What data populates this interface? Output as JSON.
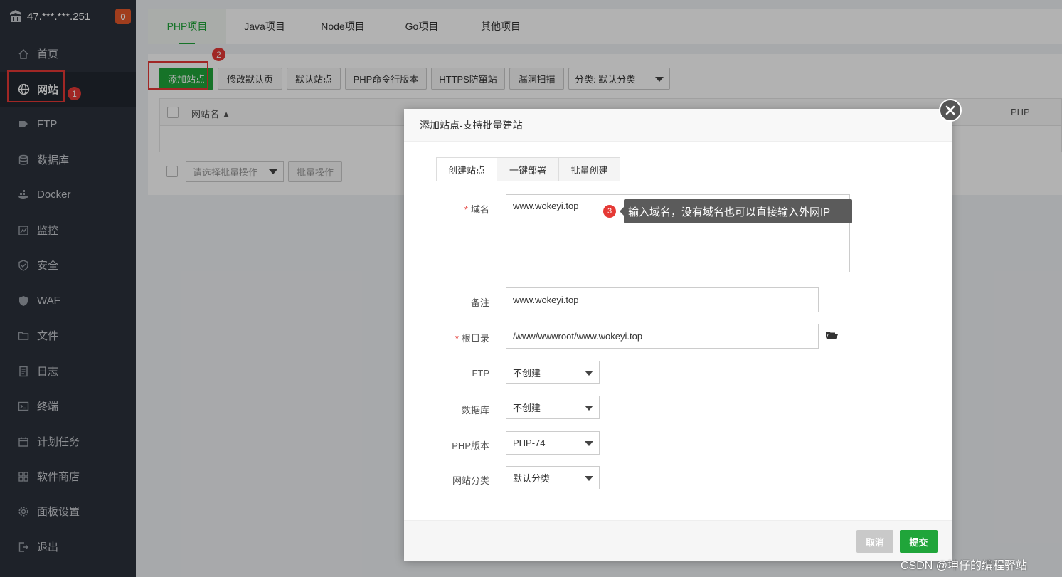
{
  "sidebar": {
    "host": "47.***.***.251",
    "badge": "0",
    "items": [
      {
        "label": "首页",
        "icon": "home-icon"
      },
      {
        "label": "网站",
        "icon": "globe-icon"
      },
      {
        "label": "FTP",
        "icon": "ftp-icon"
      },
      {
        "label": "数据库",
        "icon": "database-icon"
      },
      {
        "label": "Docker",
        "icon": "docker-icon"
      },
      {
        "label": "监控",
        "icon": "monitor-icon"
      },
      {
        "label": "安全",
        "icon": "shield-icon"
      },
      {
        "label": "WAF",
        "icon": "waf-icon"
      },
      {
        "label": "文件",
        "icon": "folder-icon"
      },
      {
        "label": "日志",
        "icon": "log-icon"
      },
      {
        "label": "终端",
        "icon": "terminal-icon"
      },
      {
        "label": "计划任务",
        "icon": "calendar-icon"
      },
      {
        "label": "软件商店",
        "icon": "store-icon"
      },
      {
        "label": "面板设置",
        "icon": "gear-icon"
      },
      {
        "label": "退出",
        "icon": "logout-icon"
      }
    ],
    "active_index": 1
  },
  "tabs": [
    "PHP项目",
    "Java项目",
    "Node项目",
    "Go项目",
    "其他项目"
  ],
  "toolbar": {
    "add_site": "添加站点",
    "modify_default": "修改默认页",
    "default_site": "默认站点",
    "php_cli": "PHP命令行版本",
    "https_guard": "HTTPS防窜站",
    "vuln_scan": "漏洞扫描",
    "category": "分类: 默认分类"
  },
  "table": {
    "col_site": "网站名 ▲",
    "col_php": "PHP",
    "batch_placeholder": "请选择批量操作",
    "batch_button": "批量操作"
  },
  "annotations": {
    "m1": "1",
    "m2": "2",
    "m3": "3",
    "tooltip": "输入域名，没有域名也可以直接输入外网IP"
  },
  "modal": {
    "title": "添加站点-支持批量建站",
    "tabs": [
      "创建站点",
      "一键部署",
      "批量创建"
    ],
    "fields": {
      "domain_label": "域名",
      "domain_value": "www.wokeyi.top",
      "note_label": "备注",
      "note_value": "www.wokeyi.top",
      "root_label": "根目录",
      "root_value": "/www/wwwroot/www.wokeyi.top",
      "ftp_label": "FTP",
      "ftp_value": "不创建",
      "db_label": "数据库",
      "db_value": "不创建",
      "php_label": "PHP版本",
      "php_value": "PHP-74",
      "category_label": "网站分类",
      "category_value": "默认分类"
    },
    "cancel": "取消",
    "submit": "提交"
  },
  "watermark": "CSDN @坤仔的编程驿站",
  "colors": {
    "accent": "#20a53a",
    "sidebar": "#2c323c",
    "marker": "#e53935"
  }
}
